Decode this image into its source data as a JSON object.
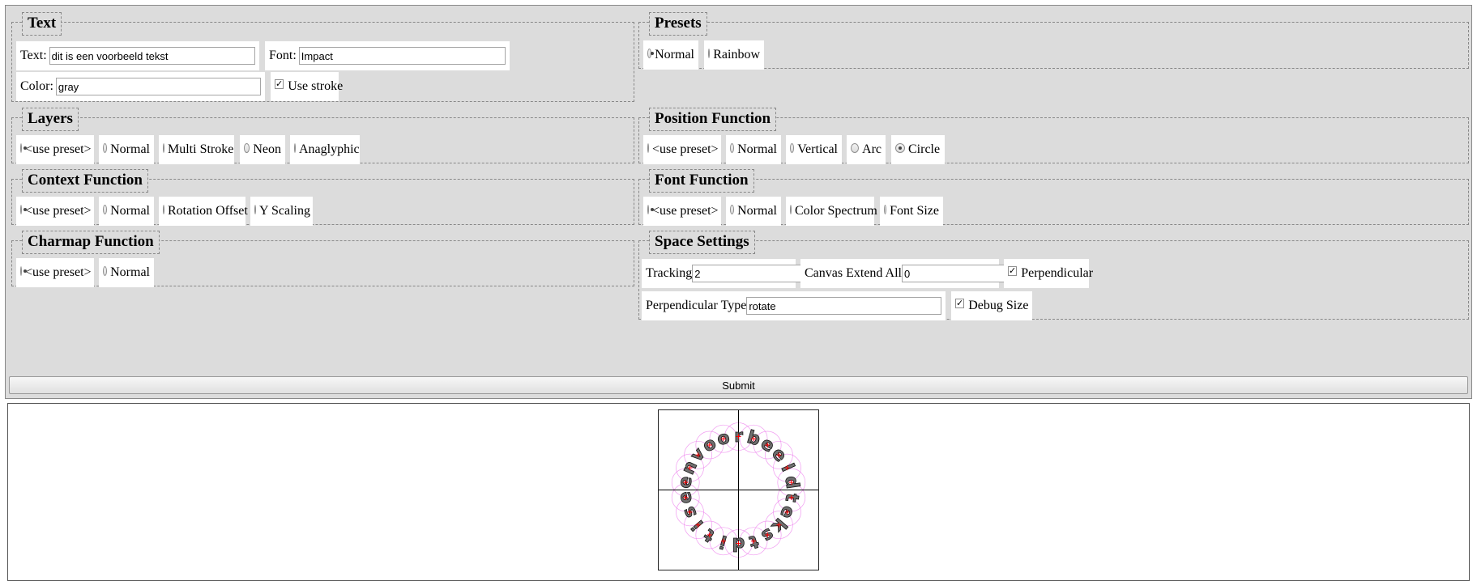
{
  "text_section": {
    "legend": "Text",
    "text_label": "Text:",
    "text_value": "dit is een voorbeeld tekst",
    "font_label": "Font:",
    "font_value": "Impact",
    "color_label": "Color:",
    "color_value": "gray",
    "use_stroke_label": "Use stroke",
    "use_stroke_checked": true
  },
  "presets": {
    "legend": "Presets",
    "options": [
      {
        "label": "Normal",
        "selected": true
      },
      {
        "label": "Rainbow",
        "selected": false
      }
    ]
  },
  "layers": {
    "legend": "Layers",
    "options": [
      {
        "label": "<use preset>",
        "selected": true
      },
      {
        "label": "Normal",
        "selected": false
      },
      {
        "label": "Multi Stroke",
        "selected": false
      },
      {
        "label": "Neon",
        "selected": false
      },
      {
        "label": "Anaglyphic",
        "selected": false
      }
    ]
  },
  "position_function": {
    "legend": "Position Function",
    "options": [
      {
        "label": "<use preset>",
        "selected": false
      },
      {
        "label": "Normal",
        "selected": false
      },
      {
        "label": "Vertical",
        "selected": false
      },
      {
        "label": "Arc",
        "selected": false
      },
      {
        "label": "Circle",
        "selected": true
      }
    ]
  },
  "context_function": {
    "legend": "Context Function",
    "options": [
      {
        "label": "<use preset>",
        "selected": true
      },
      {
        "label": "Normal",
        "selected": false
      },
      {
        "label": "Rotation Offset",
        "selected": false
      },
      {
        "label": "Y Scaling",
        "selected": false
      }
    ]
  },
  "font_function": {
    "legend": "Font Function",
    "options": [
      {
        "label": "<use preset>",
        "selected": true
      },
      {
        "label": "Normal",
        "selected": false
      },
      {
        "label": "Color Spectrum",
        "selected": false
      },
      {
        "label": "Font Size",
        "selected": false
      }
    ]
  },
  "charmap_function": {
    "legend": "Charmap Function",
    "options": [
      {
        "label": "<use preset>",
        "selected": true
      },
      {
        "label": "Normal",
        "selected": false
      }
    ]
  },
  "space_settings": {
    "legend": "Space Settings",
    "tracking_label": "Tracking",
    "tracking_value": "2",
    "canvas_extend_label": "Canvas Extend All",
    "canvas_extend_value": "0",
    "perpendicular_label": "Perpendicular",
    "perpendicular_checked": true,
    "perpendicular_type_label": "Perpendicular Type",
    "perpendicular_type_value": "rotate",
    "debug_size_label": "Debug Size",
    "debug_size_checked": true
  },
  "submit_label": "Submit",
  "output": {
    "rendered_text": "dit is een voorbeeld tekst",
    "fill_color": "#707070",
    "stroke_color": "#111111",
    "debug_color": "#ee82ee",
    "marker_color": "#ff0000"
  }
}
